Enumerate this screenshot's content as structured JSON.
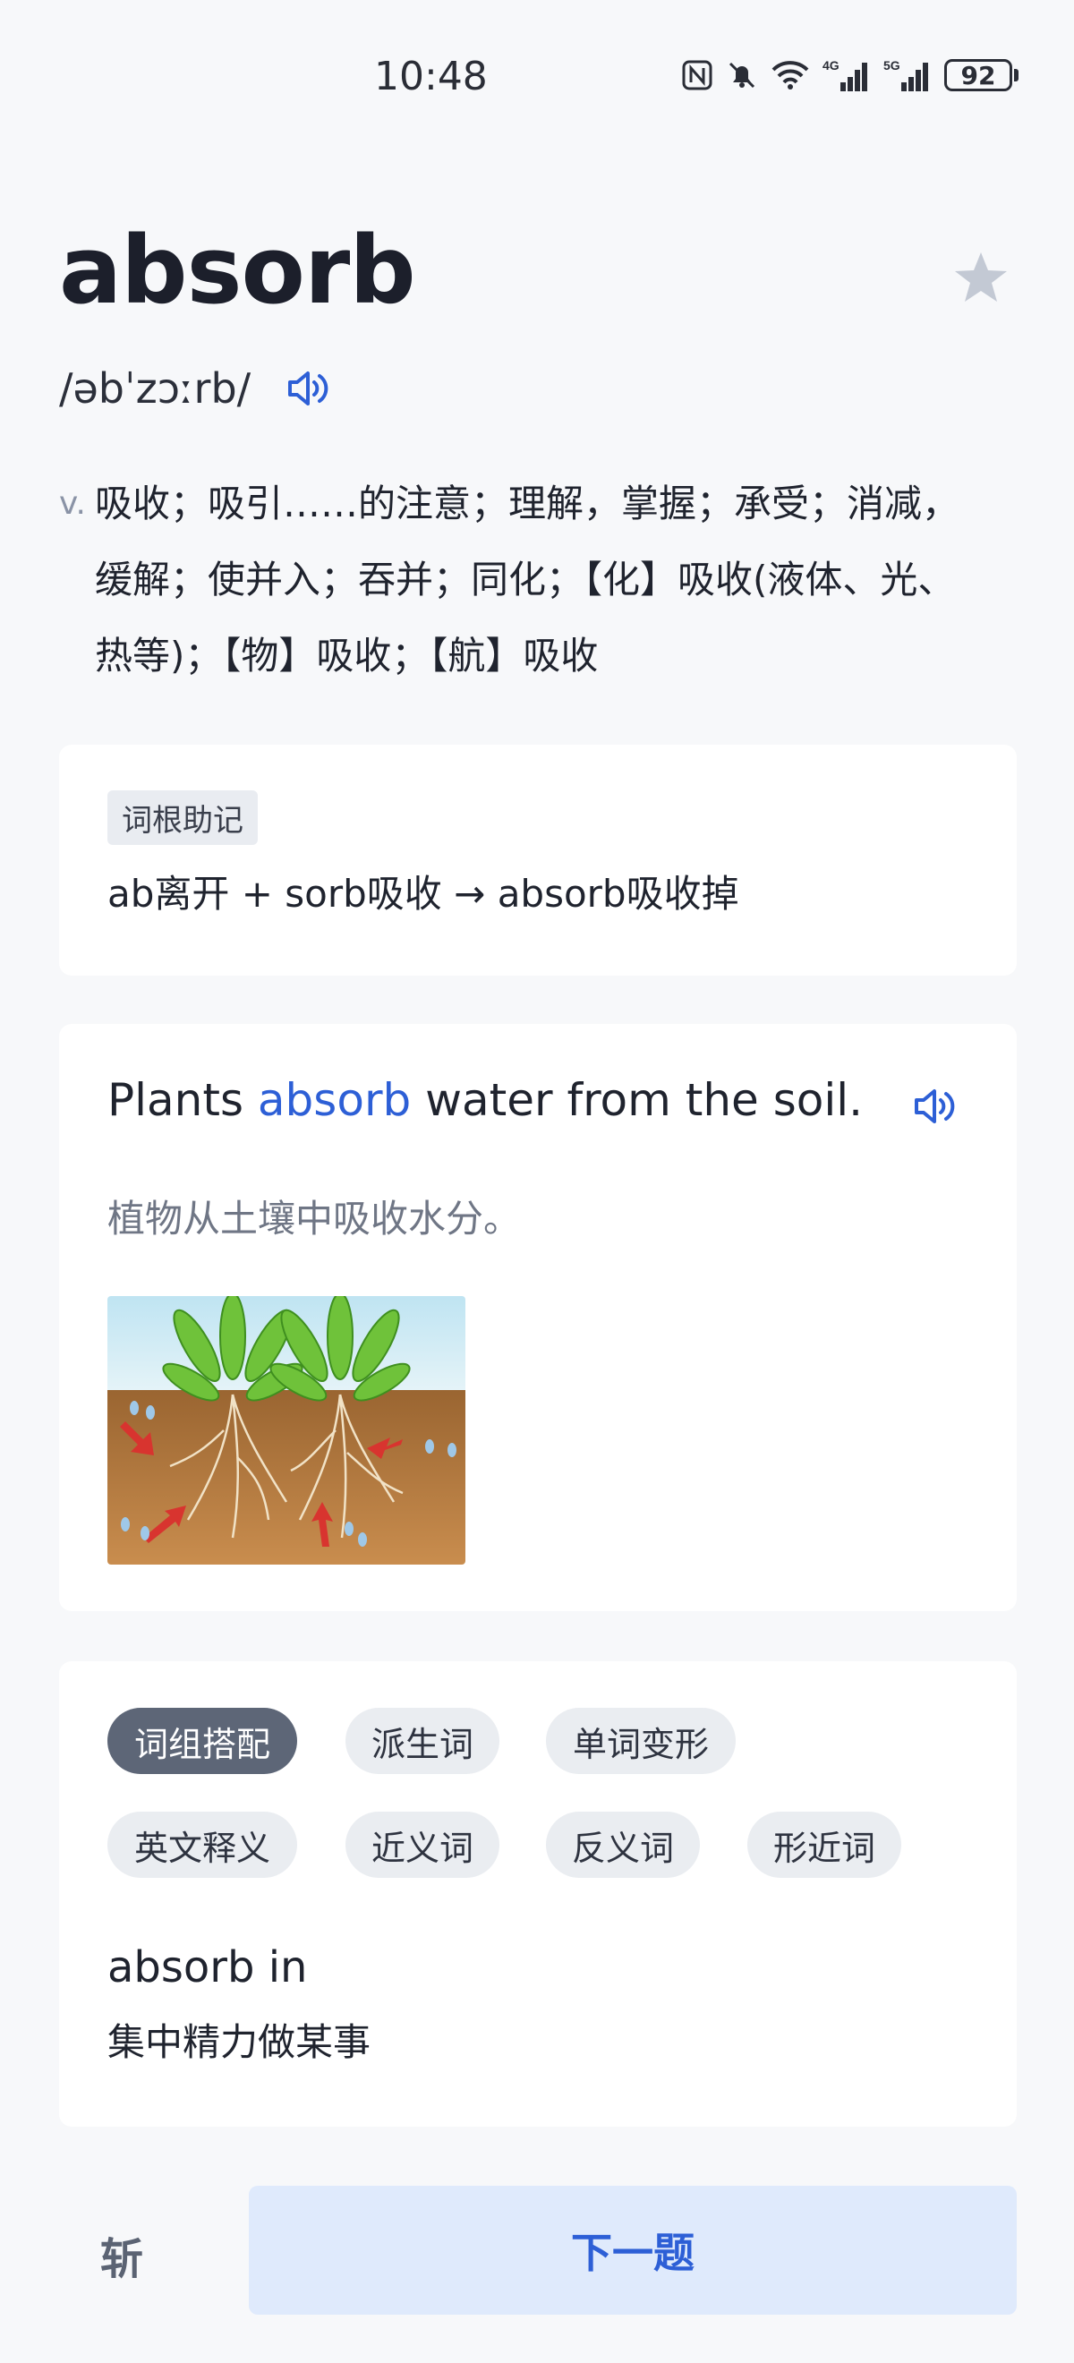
{
  "status_bar": {
    "time": "10:48",
    "battery": "92",
    "icons": [
      "nfc-icon",
      "mute-icon",
      "wifi-icon",
      "signal-4g-icon",
      "signal-5g-icon",
      "battery-icon"
    ]
  },
  "word": {
    "headword": "absorb",
    "phonetic": "/əbˈzɔːrb/",
    "favorite_icon": "star-icon",
    "speaker_icon": "speaker-icon"
  },
  "definition": {
    "pos": "v.",
    "text": "吸收；吸引……的注意；理解，掌握；承受；消减，缓解；使并入；吞并；同化；【化】吸收(液体、光、热等)；【物】吸收；【航】吸收"
  },
  "mnemonic": {
    "tag": "词根助记",
    "text": "ab离开 + sorb吸收 → absorb吸收掉"
  },
  "example": {
    "before": "Plants ",
    "highlight": "absorb",
    "after": " water from the soil.",
    "translation": "植物从土壤中吸收水分。",
    "image": "plants-absorbing-water-illustration"
  },
  "tabs": {
    "items": [
      "词组搭配",
      "派生词",
      "单词变形",
      "英文释义",
      "近义词",
      "反义词",
      "形近词"
    ],
    "active": "词组搭配"
  },
  "phrase": {
    "text": "absorb in",
    "meaning": "集中精力做某事"
  },
  "bottom": {
    "kill_label": "斩",
    "next_label": "下一题"
  },
  "colors": {
    "accent": "#2d5fd6",
    "active_chip": "#5d6677",
    "next_button_bg": "#dfeafc"
  }
}
